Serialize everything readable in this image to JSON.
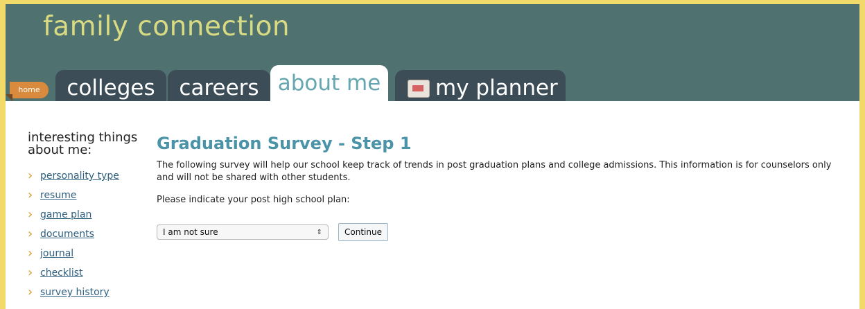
{
  "header": {
    "brand": "family connection",
    "home_label": "home"
  },
  "tabs": [
    {
      "label": "colleges"
    },
    {
      "label": "careers"
    },
    {
      "label": "about me",
      "active": true
    },
    {
      "label": "my planner"
    }
  ],
  "sidebar": {
    "title_line1": "interesting things",
    "title_line2": "about me:",
    "items": [
      {
        "label": "personality type"
      },
      {
        "label": "resume"
      },
      {
        "label": "game plan"
      },
      {
        "label": "documents"
      },
      {
        "label": "journal"
      },
      {
        "label": "checklist"
      },
      {
        "label": "survey history"
      }
    ]
  },
  "main": {
    "title": "Graduation Survey - Step 1",
    "description": "The following survey will help our school keep track of trends in post graduation plans and college admissions. This information is for counselors only and will not be shared with other students.",
    "prompt": "Please indicate your post high school plan:",
    "select_value": "I am not sure",
    "continue_label": "Continue"
  },
  "colors": {
    "frame": "#f1d96a",
    "header": "#4f7271",
    "tab": "#3d4d57",
    "active_tab_text": "#66a6b0",
    "home": "#d98a3c",
    "title": "#4b93a7",
    "link": "#2f5f7f",
    "chevron": "#d9982d"
  },
  "icons": {
    "planner": "calendar-icon",
    "sidebar_bullet": "chevron-right-icon",
    "select": "updown-arrows-icon"
  }
}
